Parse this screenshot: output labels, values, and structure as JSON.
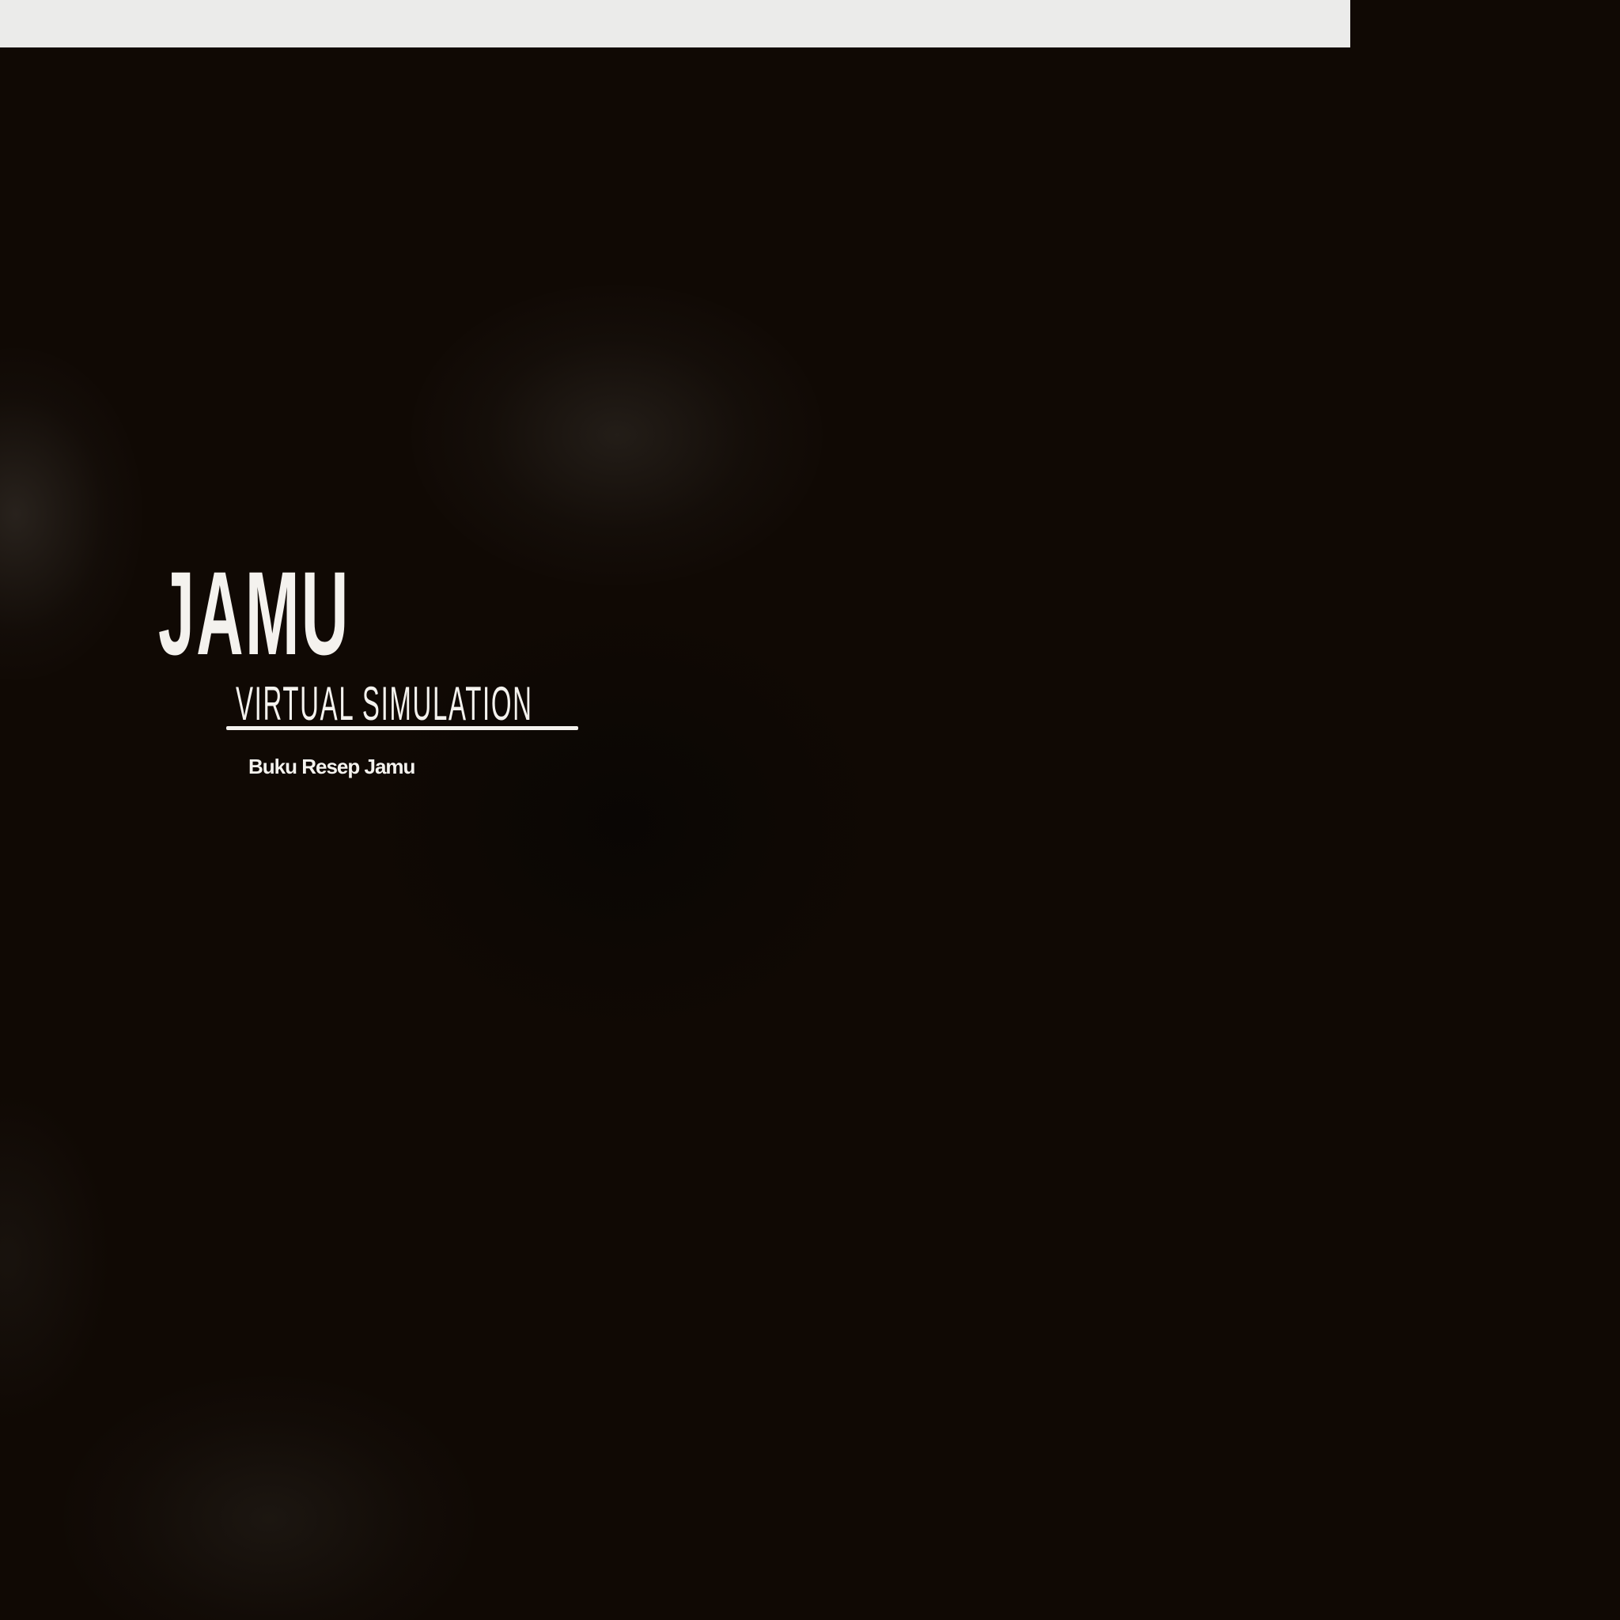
{
  "title": {
    "main": "JAMU",
    "subtitle": "VIRTUAL SIMULATION"
  },
  "menu": {
    "recipe_book_label": "Buku Resep Jamu"
  },
  "colors": {
    "background": "#100904",
    "text": "#f4f2ee",
    "top_strip": "#ebebea"
  }
}
